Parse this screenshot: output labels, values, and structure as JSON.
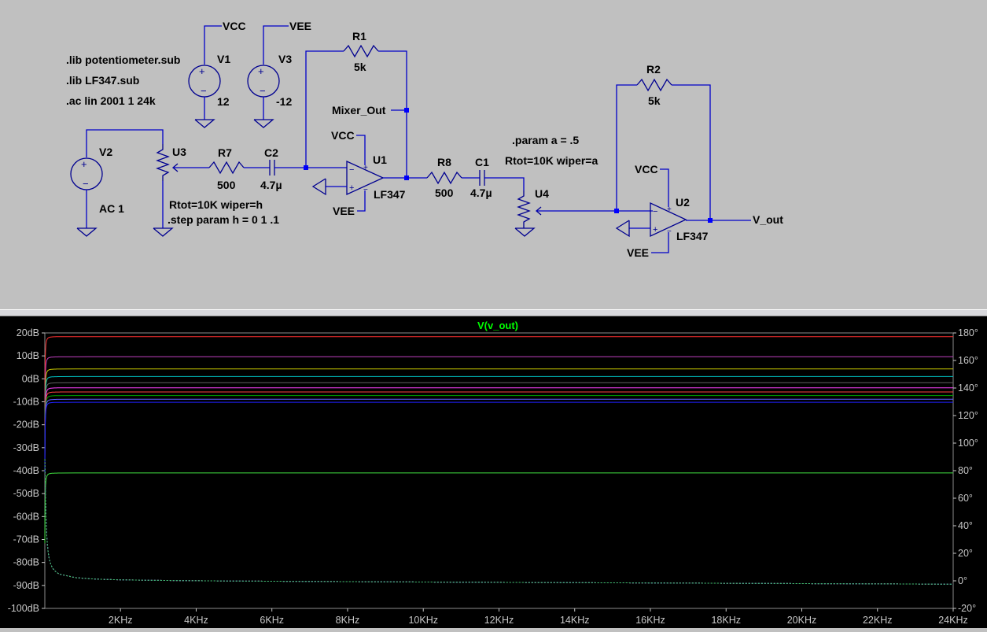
{
  "schematic": {
    "directives": [
      ".lib potentiometer.sub",
      ".lib LF347.sub",
      ".ac lin 2001 1 24k"
    ],
    "param_a": ".param a = .5",
    "u4_param": "Rtot=10K wiper=a",
    "u3_param": "Rtot=10K wiper=h",
    "step": ".step param h = 0 1 .1",
    "sources": [
      {
        "name": "V1",
        "value": "12",
        "net": "VCC"
      },
      {
        "name": "V3",
        "value": "-12",
        "net": "VEE"
      },
      {
        "name": "V2",
        "value": "AC 1"
      }
    ],
    "resistors": [
      {
        "name": "R1",
        "value": "5k"
      },
      {
        "name": "R7",
        "value": "500"
      },
      {
        "name": "R8",
        "value": "500"
      },
      {
        "name": "R2",
        "value": "5k"
      }
    ],
    "capacitors": [
      {
        "name": "C2",
        "value": "4.7µ"
      },
      {
        "name": "C1",
        "value": "4.7µ"
      }
    ],
    "potentiometers": [
      "U3",
      "U4"
    ],
    "opamps": [
      {
        "name": "U1",
        "model": "LF347",
        "vcc": "VCC",
        "vee": "VEE"
      },
      {
        "name": "U2",
        "model": "LF347",
        "vcc": "VCC",
        "vee": "VEE"
      }
    ],
    "net_labels": {
      "mixer": "Mixer_Out",
      "out": "V_out"
    }
  },
  "plot": {
    "trace_label": "V(v_out)",
    "colors": {
      "background": "#000000",
      "trace_label": "#00ff00",
      "grid": "#3a3a3a",
      "ticks": "#c8c8c8"
    },
    "left_axis": [
      "20dB",
      "10dB",
      "0dB",
      "-10dB",
      "-20dB",
      "-30dB",
      "-40dB",
      "-50dB",
      "-60dB",
      "-70dB",
      "-80dB",
      "-90dB",
      "-100dB"
    ],
    "right_axis": [
      "180°",
      "160°",
      "140°",
      "120°",
      "100°",
      "80°",
      "60°",
      "40°",
      "20°",
      "0°",
      "-20°"
    ],
    "x_axis": [
      "2KHz",
      "4KHz",
      "6KHz",
      "8KHz",
      "10KHz",
      "12KHz",
      "14KHz",
      "16KHz",
      "18KHz",
      "20KHz",
      "22KHz",
      "24KHz"
    ]
  },
  "chart_data": {
    "type": "line",
    "x_unit": "Hz",
    "xlim": [
      1,
      24000
    ],
    "ylim": [
      -100,
      20
    ],
    "y2lim": [
      -20,
      180
    ],
    "magnitude_series_dB": [
      {
        "value": 18.4,
        "color": "#ff3030"
      },
      {
        "value": 9.6,
        "color": "#c040c0"
      },
      {
        "value": 4.3,
        "color": "#c8c800"
      },
      {
        "value": 1.0,
        "color": "#00c0c0"
      },
      {
        "value": -1.7,
        "color": "#606060"
      },
      {
        "value": -3.9,
        "color": "#ff40ff"
      },
      {
        "value": -5.7,
        "color": "#ff4040"
      },
      {
        "value": -7.3,
        "color": "#00a000"
      },
      {
        "value": -8.9,
        "color": "#6060ff"
      },
      {
        "value": -10.2,
        "color": "#2020ff"
      },
      {
        "value": -41.0,
        "color": "#40e040"
      }
    ],
    "phase_series_deg": {
      "start": 0,
      "end": -2.5
    }
  }
}
